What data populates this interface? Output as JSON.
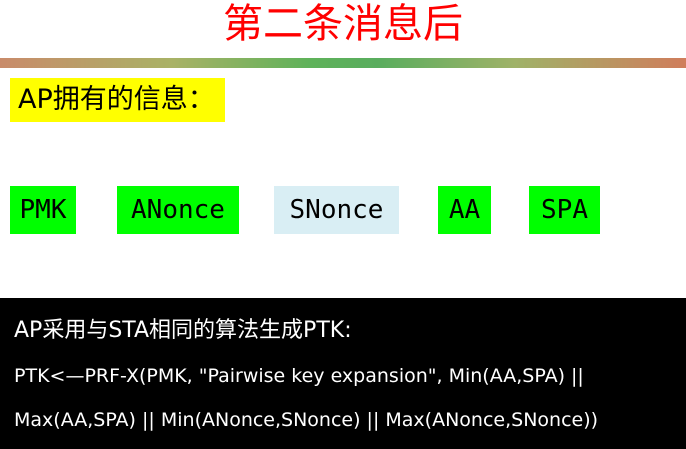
{
  "title": "第二条消息后",
  "ap_info_label": "AP拥有的信息：",
  "items": [
    {
      "label": "PMK",
      "color": "#00ff00"
    },
    {
      "label": "ANonce",
      "color": "#00ff00"
    },
    {
      "label": "SNonce",
      "color": "#d9eef4"
    },
    {
      "label": "AA",
      "color": "#00ff00"
    },
    {
      "label": "SPA",
      "color": "#00ff00"
    }
  ],
  "info_box": {
    "heading": "AP采用与STA相同的算法生成PTK:",
    "line1": "PTK<—PRF-X(PMK, \"Pairwise key expansion\", Min(AA,SPA) ||",
    "line2": "Max(AA,SPA) || Min(ANonce,SNonce) || Max(ANonce,SNonce))"
  }
}
